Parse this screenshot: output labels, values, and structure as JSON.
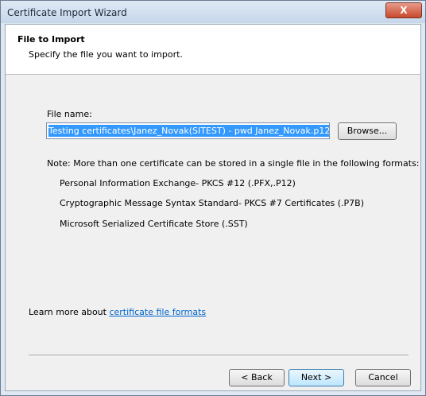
{
  "window": {
    "title": "Certificate Import Wizard",
    "close_glyph": "X"
  },
  "header": {
    "title": "File to Import",
    "subtitle": "Specify the file you want to import."
  },
  "form": {
    "file_label": "File name:",
    "file_value": "Testing certificates\\Janez_Novak(SITEST) - pwd Janez_Novak.p12",
    "browse_label": "Browse..."
  },
  "note": {
    "text": "Note:  More than one certificate can be stored in a single file in the following formats:",
    "formats": [
      "Personal Information Exchange- PKCS #12 (.PFX,.P12)",
      "Cryptographic Message Syntax Standard- PKCS #7 Certificates (.P7B)",
      "Microsoft Serialized Certificate Store (.SST)"
    ]
  },
  "learn_more": {
    "prefix": "Learn more about ",
    "link": "certificate file formats"
  },
  "footer": {
    "back_label": "< Back",
    "next_label": "Next >",
    "cancel_label": "Cancel"
  }
}
